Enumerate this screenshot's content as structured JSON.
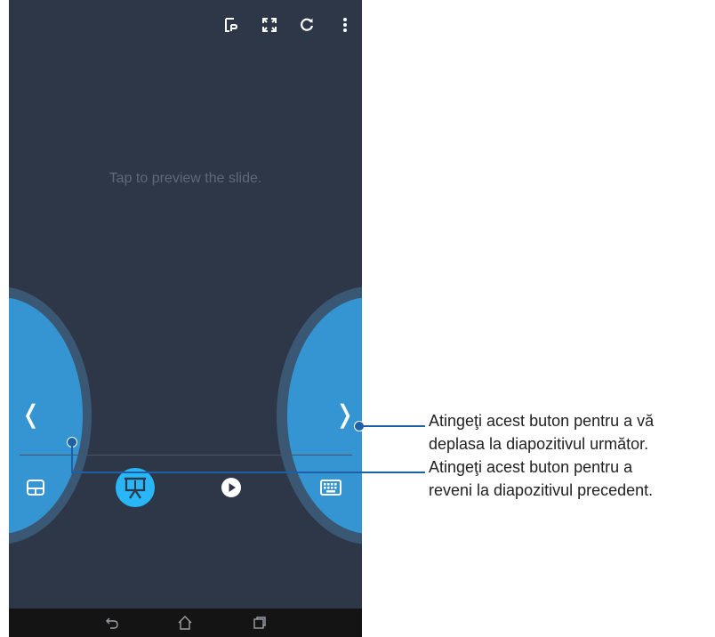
{
  "screen": {
    "preview_text": "Tap to preview the slide."
  },
  "topbar": {
    "icons": [
      "presenter-notes-icon",
      "fullscreen-icon",
      "refresh-icon",
      "more-options-icon"
    ]
  },
  "navigation": {
    "prev_symbol": "❬",
    "next_symbol": "❭"
  },
  "bottombar": {
    "icons": [
      "layout-icon",
      "presentation-icon",
      "play-icon",
      "keyboard-icon"
    ],
    "active_index": 1
  },
  "system_nav": {
    "icons": [
      "back-icon",
      "home-icon",
      "recent-apps-icon"
    ]
  },
  "callouts": {
    "next_line1": "Atingeţi acest buton pentru a vă",
    "next_line2": "deplasa la diapozitivul următor.",
    "prev_line1": "Atingeţi acest buton pentru a",
    "prev_line2": "reveni la diapozitivul precedent."
  },
  "colors": {
    "screen_bg": "#2d3747",
    "button_blue": "#3495d2",
    "active_highlight": "#29b6f6",
    "callout": "#1e5fa6"
  }
}
